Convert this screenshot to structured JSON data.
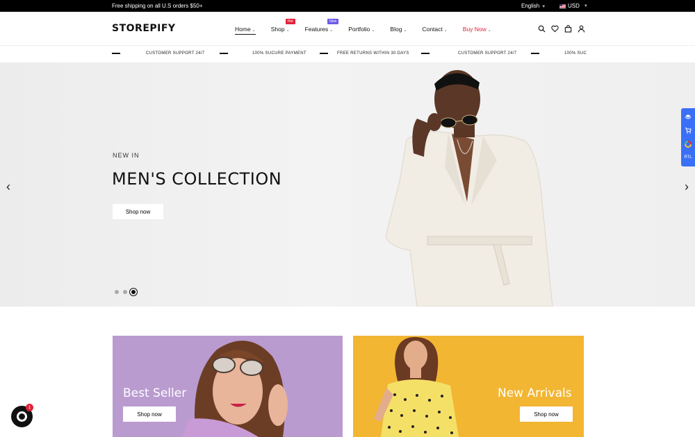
{
  "topbar": {
    "announcement": "Free shipping on all U.S orders $50+",
    "language": "English",
    "currency": "USD"
  },
  "header": {
    "logo": "STOREPIFY",
    "nav": [
      {
        "label": "Home"
      },
      {
        "label": "Shop",
        "badge": "Hot"
      },
      {
        "label": "Features",
        "badge": "New"
      },
      {
        "label": "Portfolio"
      },
      {
        "label": "Blog"
      },
      {
        "label": "Contact"
      },
      {
        "label": "Buy Now"
      }
    ],
    "icons": [
      "search-icon",
      "heart-icon",
      "bag-icon",
      "user-icon"
    ]
  },
  "ticker": [
    "CUSTOMER SUPPORT 24/7",
    "100% SUCURE PAYMENT",
    "FREE RETURNS WITHIN 30 DAYS",
    "CUSTOMER SUPPORT 24/7",
    "100% SUC"
  ],
  "hero": {
    "eyebrow": "NEW IN",
    "title": "MEN'S COLLECTION",
    "button": "Shop now",
    "slide_count": 3,
    "active_slide": 3
  },
  "side_panel": {
    "rtl_label": "RTL"
  },
  "banners": [
    {
      "title": "Best Seller",
      "button": "Shop now",
      "color": "#b99bd0"
    },
    {
      "title": "New Arrivals",
      "button": "Shop now",
      "color": "#f2b633"
    }
  ],
  "chat": {
    "count": "1"
  },
  "colors": {
    "accent_red": "#e0233a",
    "side_panel_blue": "#3a6ff7"
  }
}
